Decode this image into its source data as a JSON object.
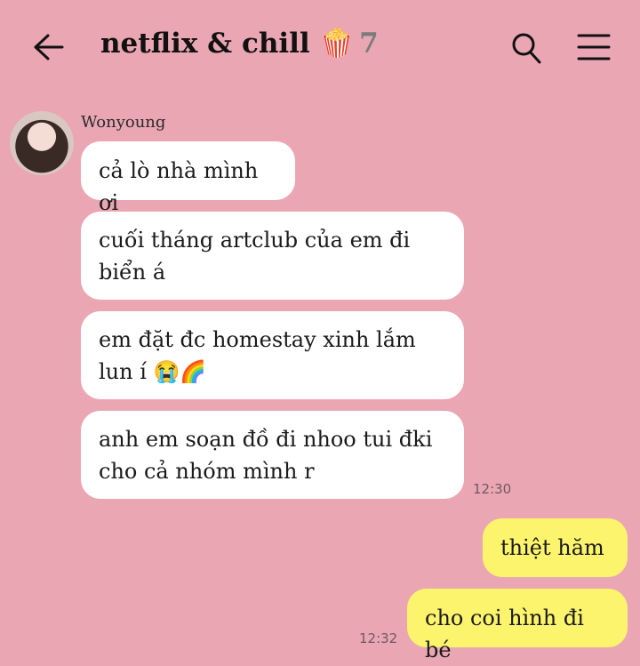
{
  "header": {
    "title": "netflix & chill 🍿",
    "member_count": "7",
    "back_icon": "arrow-left-icon",
    "search_icon": "search-icon",
    "menu_icon": "hamburger-menu-icon"
  },
  "chat": {
    "sender_name": "Wonyoung",
    "incoming": [
      "cả lò nhà mình ơi",
      "cuối tháng artclub của em đi biển á",
      "em đặt đc homestay xinh lắm lun í 😭🌈",
      "anh em soạn đồ đi nhoo tui đki cho cả nhóm mình r"
    ],
    "incoming_time": "12:30",
    "outgoing": [
      "thiệt hăm",
      "cho coi hình đi bé"
    ],
    "outgoing_time": "12:32"
  },
  "colors": {
    "background": "#eaa7b3",
    "incoming_bubble": "#ffffff",
    "outgoing_bubble": "#fdf46d"
  }
}
